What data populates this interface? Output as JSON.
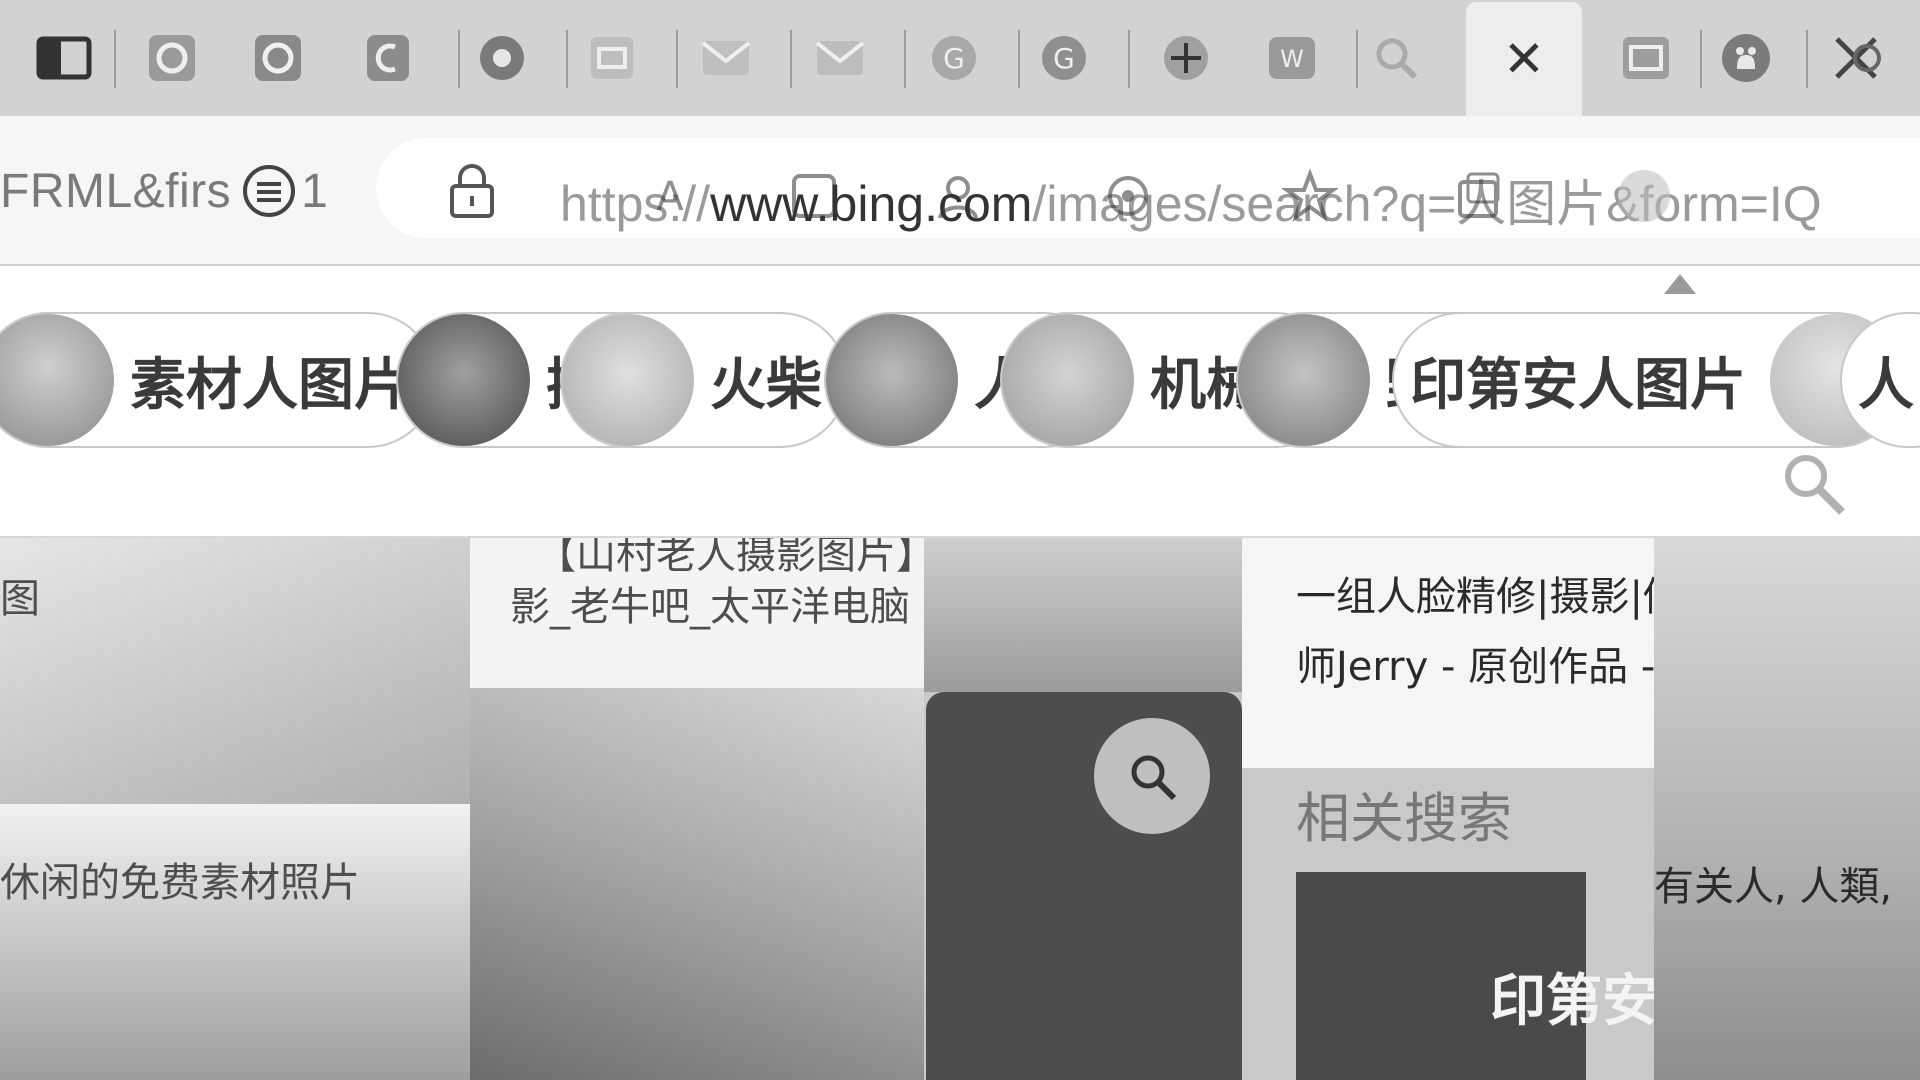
{
  "tabs": [
    {
      "icon": "cross-icon"
    },
    {
      "icon": "chat-icon"
    },
    {
      "icon": "edge-icon"
    },
    {
      "icon": "bing-icon"
    },
    {
      "icon": "chrome-icon"
    },
    {
      "icon": "bird-icon"
    },
    {
      "icon": "mail-icon"
    },
    {
      "icon": "mail-icon"
    },
    {
      "icon": "photo-icon"
    },
    {
      "icon": "photo-icon"
    },
    {
      "icon": "github-icon"
    },
    {
      "icon": "plus-icon"
    },
    {
      "icon": "grid-icon"
    },
    {
      "icon": "search-icon"
    },
    {
      "icon": "close-icon",
      "active": true,
      "label": "✕"
    },
    {
      "icon": "document-icon"
    },
    {
      "icon": "github-icon"
    },
    {
      "icon": "copilot-icon"
    }
  ],
  "toolbar": {
    "previous_url_fragment": "FRML&firs",
    "previous_url_suffix": "1",
    "url_scheme": "https://",
    "url_host": "www.bing.com",
    "url_path": "/images/search?q=人图片&form=IQ"
  },
  "chips": [
    {
      "label": "素材人图片"
    },
    {
      "label": "插图"
    },
    {
      "label": "火柴"
    },
    {
      "label": "人像"
    },
    {
      "label": "机械人"
    },
    {
      "label": "野人"
    },
    {
      "label": "印第安人图片"
    },
    {
      "label": "人"
    }
  ],
  "results": {
    "captions": [
      {
        "text": "图"
      },
      {
        "text": "【山村老人摄影图片】公园纪实摄"
      },
      {
        "text": "影_老牛吧_太平洋电脑 ..."
      },
      {
        "text": "一组人脸精修|摄影|修图/后期|修"
      },
      {
        "text": "师Jerry - 原创作品 - 站酷"
      },
      {
        "text": "休闲的免费素材照片"
      },
      {
        "text": "有关人, 人類,"
      }
    ],
    "related_title": "相关搜索",
    "related_item": "印第安人图片"
  }
}
